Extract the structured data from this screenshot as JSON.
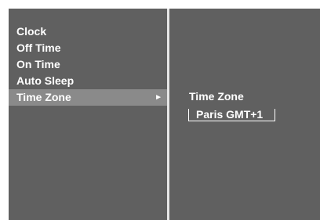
{
  "menu": {
    "items": [
      {
        "label": "Clock",
        "selected": false
      },
      {
        "label": "Off Time",
        "selected": false
      },
      {
        "label": "On Time",
        "selected": false
      },
      {
        "label": "Auto Sleep",
        "selected": false
      },
      {
        "label": "Time Zone",
        "selected": true
      }
    ],
    "selected_arrow": "►"
  },
  "submenu": {
    "title": "Time Zone",
    "value": "Paris GMT+1"
  },
  "colors": {
    "panel_background": "#606060",
    "highlight": "#8a8a8a",
    "text": "#ffffff",
    "divider": "#e6e6e6"
  }
}
